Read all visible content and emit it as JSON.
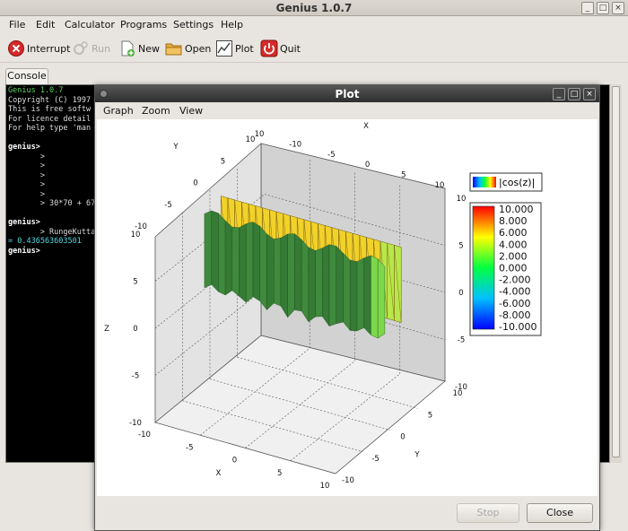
{
  "window": {
    "title": "Genius 1.0.7"
  },
  "menu": [
    "File",
    "Edit",
    "Calculator",
    "Programs",
    "Settings",
    "Help"
  ],
  "toolbar": {
    "interrupt": "Interrupt",
    "run": "Run",
    "new": "New",
    "open": "Open",
    "plot": "Plot",
    "quit": "Quit"
  },
  "tab": {
    "console": "Console"
  },
  "console_lines": [
    "Genius 1.0.7",
    "Copyright (C) 1997",
    "This is free softw",
    "For licence detail",
    "For help type 'man",
    "",
    "genius>",
    "       >",
    "       >",
    "       >",
    "       >",
    "       >",
    "       > 30*70 + 67",
    "",
    "genius>",
    "       > RungeKutta",
    "= 0.436563603501",
    "genius>"
  ],
  "plot_window": {
    "title": "Plot",
    "menu": [
      "Graph",
      "Zoom",
      "View"
    ],
    "stop": "Stop",
    "close": "Close"
  },
  "chart_data": {
    "type": "surface3d",
    "title": "",
    "legend": "|cos(z)|",
    "colorbar_ticks": [
      "10.000",
      "8.000",
      "6.000",
      "4.000",
      "2.000",
      "0.000",
      "-2.000",
      "-4.000",
      "-6.000",
      "-8.000",
      "-10.000"
    ],
    "colorbar_range": [
      -10,
      10
    ],
    "x_axis": {
      "label": "X",
      "ticks": [
        "-10",
        "-5",
        "0",
        "5",
        "10"
      ],
      "range": [
        -10,
        10
      ]
    },
    "y_axis": {
      "label": "Y",
      "ticks": [
        "-10",
        "-5",
        "0",
        "5",
        "10"
      ],
      "range": [
        -10,
        10
      ]
    },
    "z_axis": {
      "label": "Z",
      "ticks": [
        "-10",
        "-5",
        "0",
        "5",
        "10"
      ],
      "range": [
        -10,
        10
      ]
    },
    "top_x_ticks": [
      "10",
      "-10",
      "-5",
      "0",
      "5",
      "10"
    ],
    "top_y_ticks": [
      "-10",
      "-5",
      "0",
      "5",
      "10"
    ],
    "right_z_ticks": [
      "10",
      "5",
      "0",
      "-5",
      "-10"
    ],
    "colors": {
      "surface_yellow": "#f2d12a",
      "surface_green": "#3a7d3a",
      "background": "#ffffff"
    }
  }
}
